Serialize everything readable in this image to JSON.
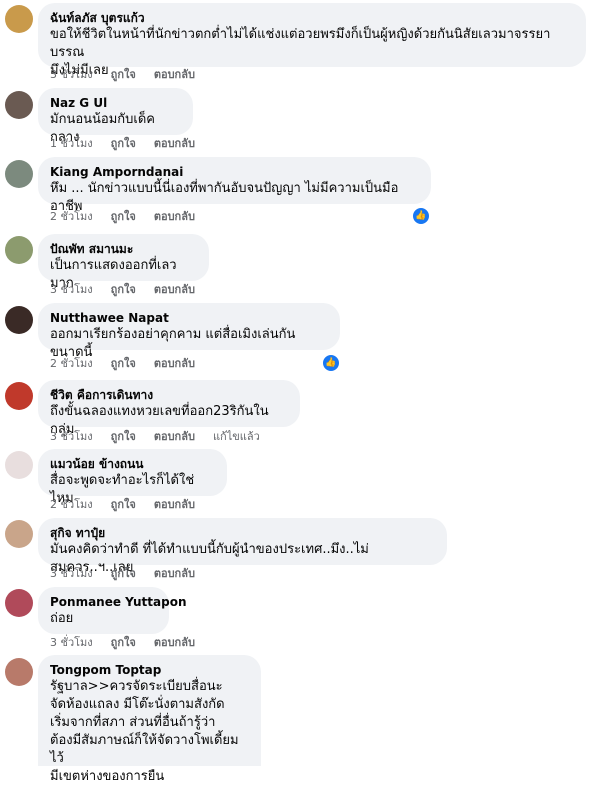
{
  "comments": [
    {
      "author": "ฉันท์ลภัส บุตรแก้ว",
      "text": "ขอให้ชีวิตในหน้าที่นักข่าวตกต่ำไม่ได้แช่งแต่อวยพรมึงก็เป็นผู้หญิงด้วยกันนิสัยเลวมาจรรยาบรรณ\nมึงไม่มีเลย",
      "time": "3 ชั่วโมง",
      "like": "ถูกใจ",
      "reply": "ตอบกลับ",
      "avatar_color": "#c99a4b"
    },
    {
      "author": "Naz G Ul",
      "text": "มักนอนน้อมกับเด็คกลาง",
      "time": "1 ชั่วโมง",
      "like": "ถูกใจ",
      "reply": "ตอบกลับ",
      "avatar_color": "#6a5a52"
    },
    {
      "author": "Kiang Amporndanai",
      "text": "หึม ... นักข่าวแบบนี้นี่เองที่พากันอับจนปัญญา ไม่มีความเป็นมืออาชีพ",
      "time": "2 ชั่วโมง",
      "like": "ถูกใจ",
      "reply": "ตอบกลับ",
      "avatar_color": "#7c8a7e"
    },
    {
      "author": "ปัณพัท สมานมะ",
      "text": "เป็นการแสดงออกที่เลวมาก",
      "time": "3 ชั่วโมง",
      "like": "ถูกใจ",
      "reply": "ตอบกลับ",
      "avatar_color": "#8c9b6e"
    },
    {
      "author": "Nutthawee Napat",
      "text": "ออกมาเรียกร้องอย่าคุกคาม แต่สื่อเมิงเล่นกันขนาดนี้",
      "time": "2 ชั่วโมง",
      "like": "ถูกใจ",
      "reply": "ตอบกลับ",
      "avatar_color": "#3a2a26"
    },
    {
      "author": "ชีวิต คือการเดินทาง",
      "text": "ถึงขั้นฉลองแทงหวยเลขที่ออก23ริกันในกลุ่ม",
      "time": "3 ชั่วโมง",
      "like": "ถูกใจ",
      "reply": "ตอบกลับ",
      "edited": "แก้ไขแล้ว",
      "avatar_color": "#c0392b"
    },
    {
      "author": "แมวน้อย ข้างถนน",
      "text": "สื่อจะพูดจะทำอะไรก็ได้ใช่ไหม",
      "time": "2 ชั่วโมง",
      "like": "ถูกใจ",
      "reply": "ตอบกลับ",
      "avatar_color": "#e8dede"
    },
    {
      "author": "สุกิจ ทาปุ๋ย",
      "text": "มันคงคิดว่าทำดี ที่ได้ทำแบบนี้กับผู้นำของประเทศ..มึง..ไม่สมควร..ฯ..เลย",
      "time": "3 ชั่วโมง",
      "like": "ถูกใจ",
      "reply": "ตอบกลับ",
      "avatar_color": "#c9a58a"
    },
    {
      "author": "Ponmanee Yuttapon",
      "text": "ถ่อย",
      "time": "3 ชั่วโมง",
      "like": "ถูกใจ",
      "reply": "ตอบกลับ",
      "avatar_color": "#b04a5a"
    },
    {
      "author": "Tongpom Toptap",
      "text": "รัฐบาล>>ควรจัดระเบียบสื่อนะ\nจัดห้องแถลง มีโต๊ะนั่งตามสังกัด\nเริ่มจากที่สภา ส่วนที่อื่นถ้ารู้ว่า\nต้องมีสัมภาษณ์ก็ให้จัดวางโพเดี้ยมไว้\nมีเขตห่างของการยืน",
      "avatar_color": "#b87a6a"
    }
  ],
  "reaction": {
    "icon": "like-icon",
    "color": "#1877f2"
  }
}
